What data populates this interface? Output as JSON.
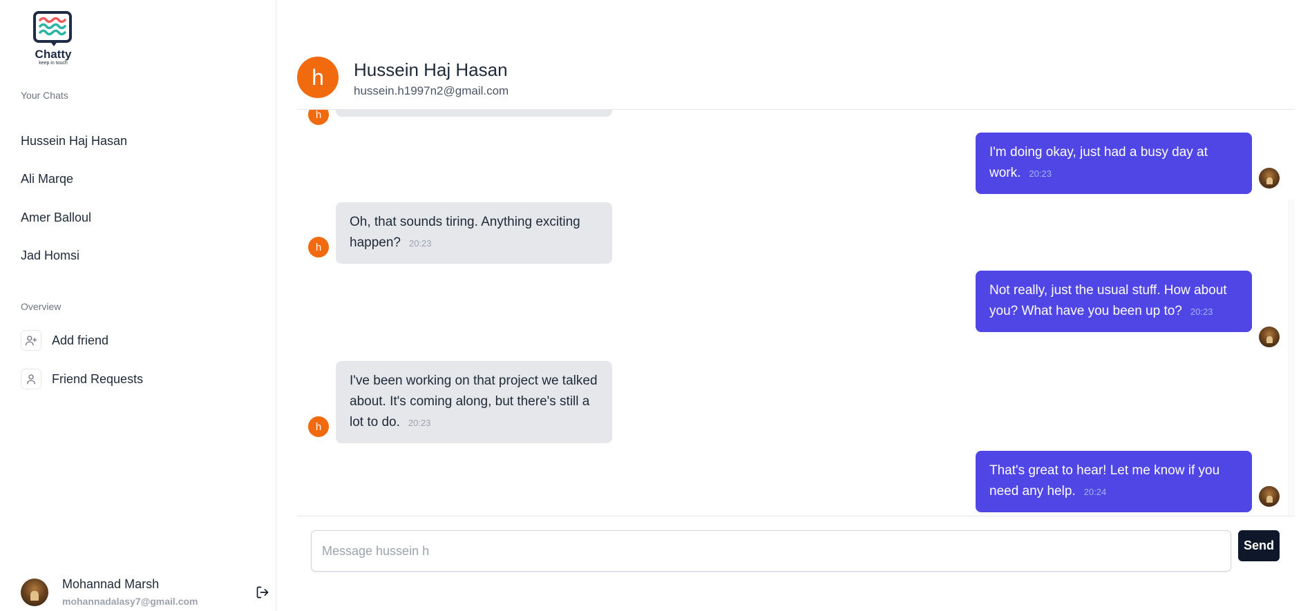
{
  "app": {
    "name": "Chatty",
    "tagline": "keep in touch",
    "colors": {
      "accent": "#4f46e5",
      "avatar_orange": "#f16a0e",
      "dark": "#0f172a"
    }
  },
  "sidebar": {
    "chats_label": "Your Chats",
    "chats": [
      {
        "name": "Hussein Haj Hasan"
      },
      {
        "name": "Ali Marqe"
      },
      {
        "name": "Amer Balloul"
      },
      {
        "name": "Jad Homsi"
      }
    ],
    "overview_label": "Overview",
    "overview": [
      {
        "label": "Add friend",
        "icon": "user-plus-icon"
      },
      {
        "label": "Friend Requests",
        "icon": "user-icon"
      }
    ],
    "user": {
      "name": "Mohannad Marsh",
      "email": "mohannadalasy7@gmail.com"
    },
    "logout_icon": "logout-icon"
  },
  "chat": {
    "partner": {
      "initial": "h",
      "name": "Hussein Haj Hasan",
      "email": "hussein.h1997n2@gmail.com"
    },
    "messages": [
      {
        "from": "me",
        "text": "I'm doing okay, just had a busy day at work.",
        "time": "20:23"
      },
      {
        "from": "them",
        "text": "Oh, that sounds tiring. Anything exciting happen?",
        "time": "20:23"
      },
      {
        "from": "me",
        "text": "Not really, just the usual stuff. How about you? What have you been up to?",
        "time": "20:23"
      },
      {
        "from": "them",
        "text": "I've been working on that project we talked about. It's coming along, but there's still a lot to do.",
        "time": "20:23"
      },
      {
        "from": "me",
        "text": "That's great to hear! Let me know if you need any help.",
        "time": "20:24"
      }
    ]
  },
  "composer": {
    "placeholder": "Message hussein h",
    "value": "",
    "send_label": "Send"
  }
}
